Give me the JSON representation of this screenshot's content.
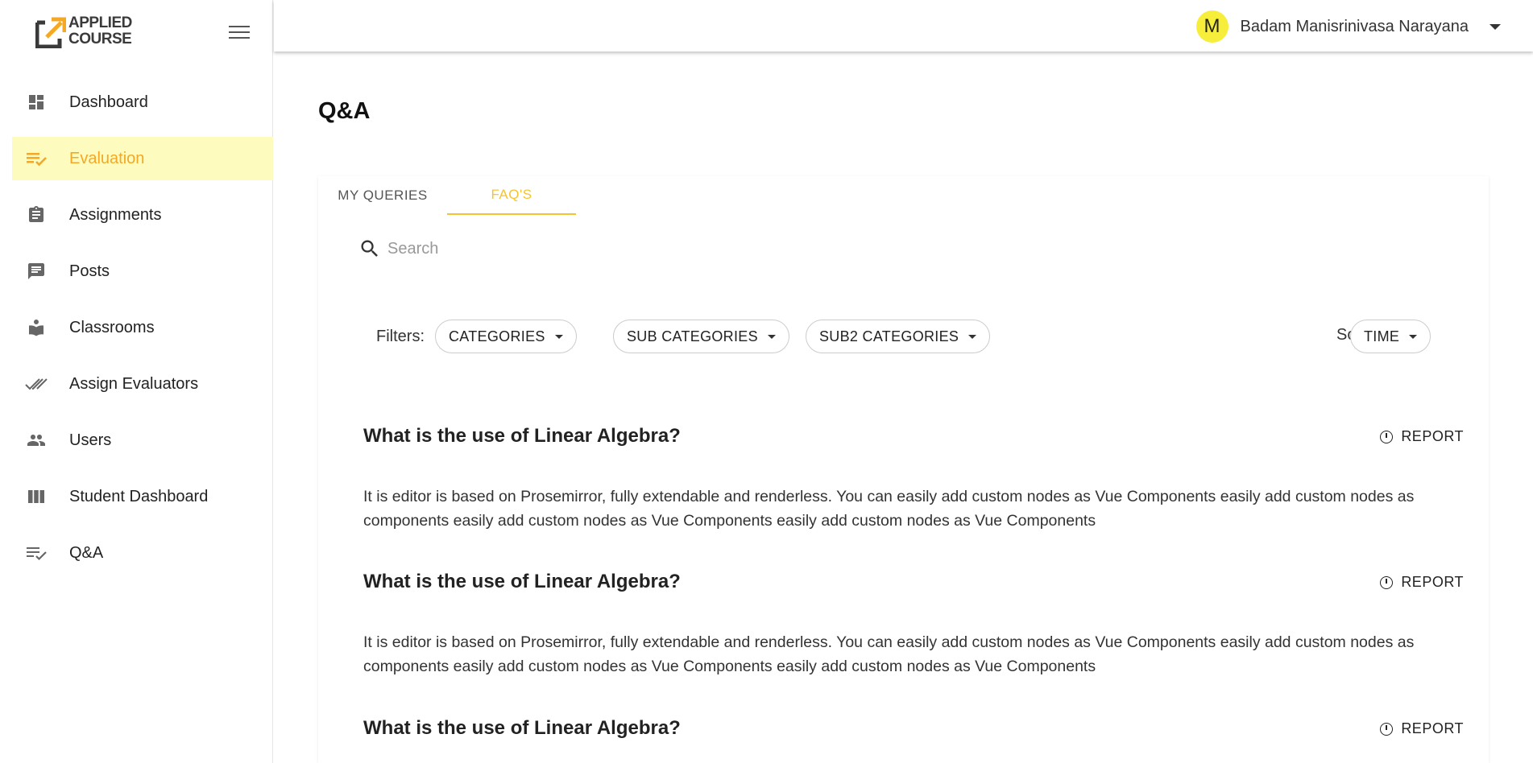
{
  "logo": {
    "line1": "APPLIED",
    "line2": "COURSE"
  },
  "sidebar": {
    "items": [
      {
        "label": "Dashboard",
        "icon": "dashboard-icon"
      },
      {
        "label": "Evaluation",
        "icon": "evaluation-icon",
        "active": true
      },
      {
        "label": "Assignments",
        "icon": "assignment-icon"
      },
      {
        "label": "Posts",
        "icon": "posts-icon"
      },
      {
        "label": "Classrooms",
        "icon": "classroom-icon"
      },
      {
        "label": "Assign Evaluators",
        "icon": "double-check-icon"
      },
      {
        "label": "Users",
        "icon": "users-icon"
      },
      {
        "label": "Student Dashboard",
        "icon": "columns-icon"
      },
      {
        "label": "Q&A",
        "icon": "qa-icon"
      }
    ]
  },
  "user": {
    "initial": "M",
    "name": "Badam Manisrinivasa Narayana"
  },
  "page": {
    "title": "Q&A"
  },
  "tabs": [
    {
      "label": "MY QUERIES"
    },
    {
      "label": "FAQ'S",
      "active": true
    }
  ],
  "search": {
    "placeholder": "Search"
  },
  "filters": {
    "label": "Filters:",
    "categories": "CATEGORIES",
    "sub_categories": "SUB CATEGORIES",
    "sub2_categories": "SUB2 CATEGORIES",
    "sort_label": "Sort By:",
    "sort_value": "TIME"
  },
  "faqs": [
    {
      "question": "What is the use of Linear Algebra?",
      "answer": "It is editor is based on Prosemirror, fully extendable and renderless. You can easily add custom nodes as Vue Components easily add custom nodes as components easily add custom nodes as Vue Components easily add custom nodes as Vue Components",
      "report": "REPORT"
    },
    {
      "question": "What is the use of Linear Algebra?",
      "answer": "It is editor is based on Prosemirror, fully extendable and renderless. You can easily add custom nodes as Vue Components easily add custom nodes as components easily add custom nodes as Vue Components easily add custom nodes as Vue Components",
      "report": "REPORT"
    },
    {
      "question": "What is the use of Linear Algebra?",
      "answer": "",
      "report": "REPORT"
    }
  ],
  "colors": {
    "accent": "#f4c430",
    "active_bg": "#fdfcbe",
    "active_text": "#f4a825",
    "avatar": "#f6ee3a"
  }
}
